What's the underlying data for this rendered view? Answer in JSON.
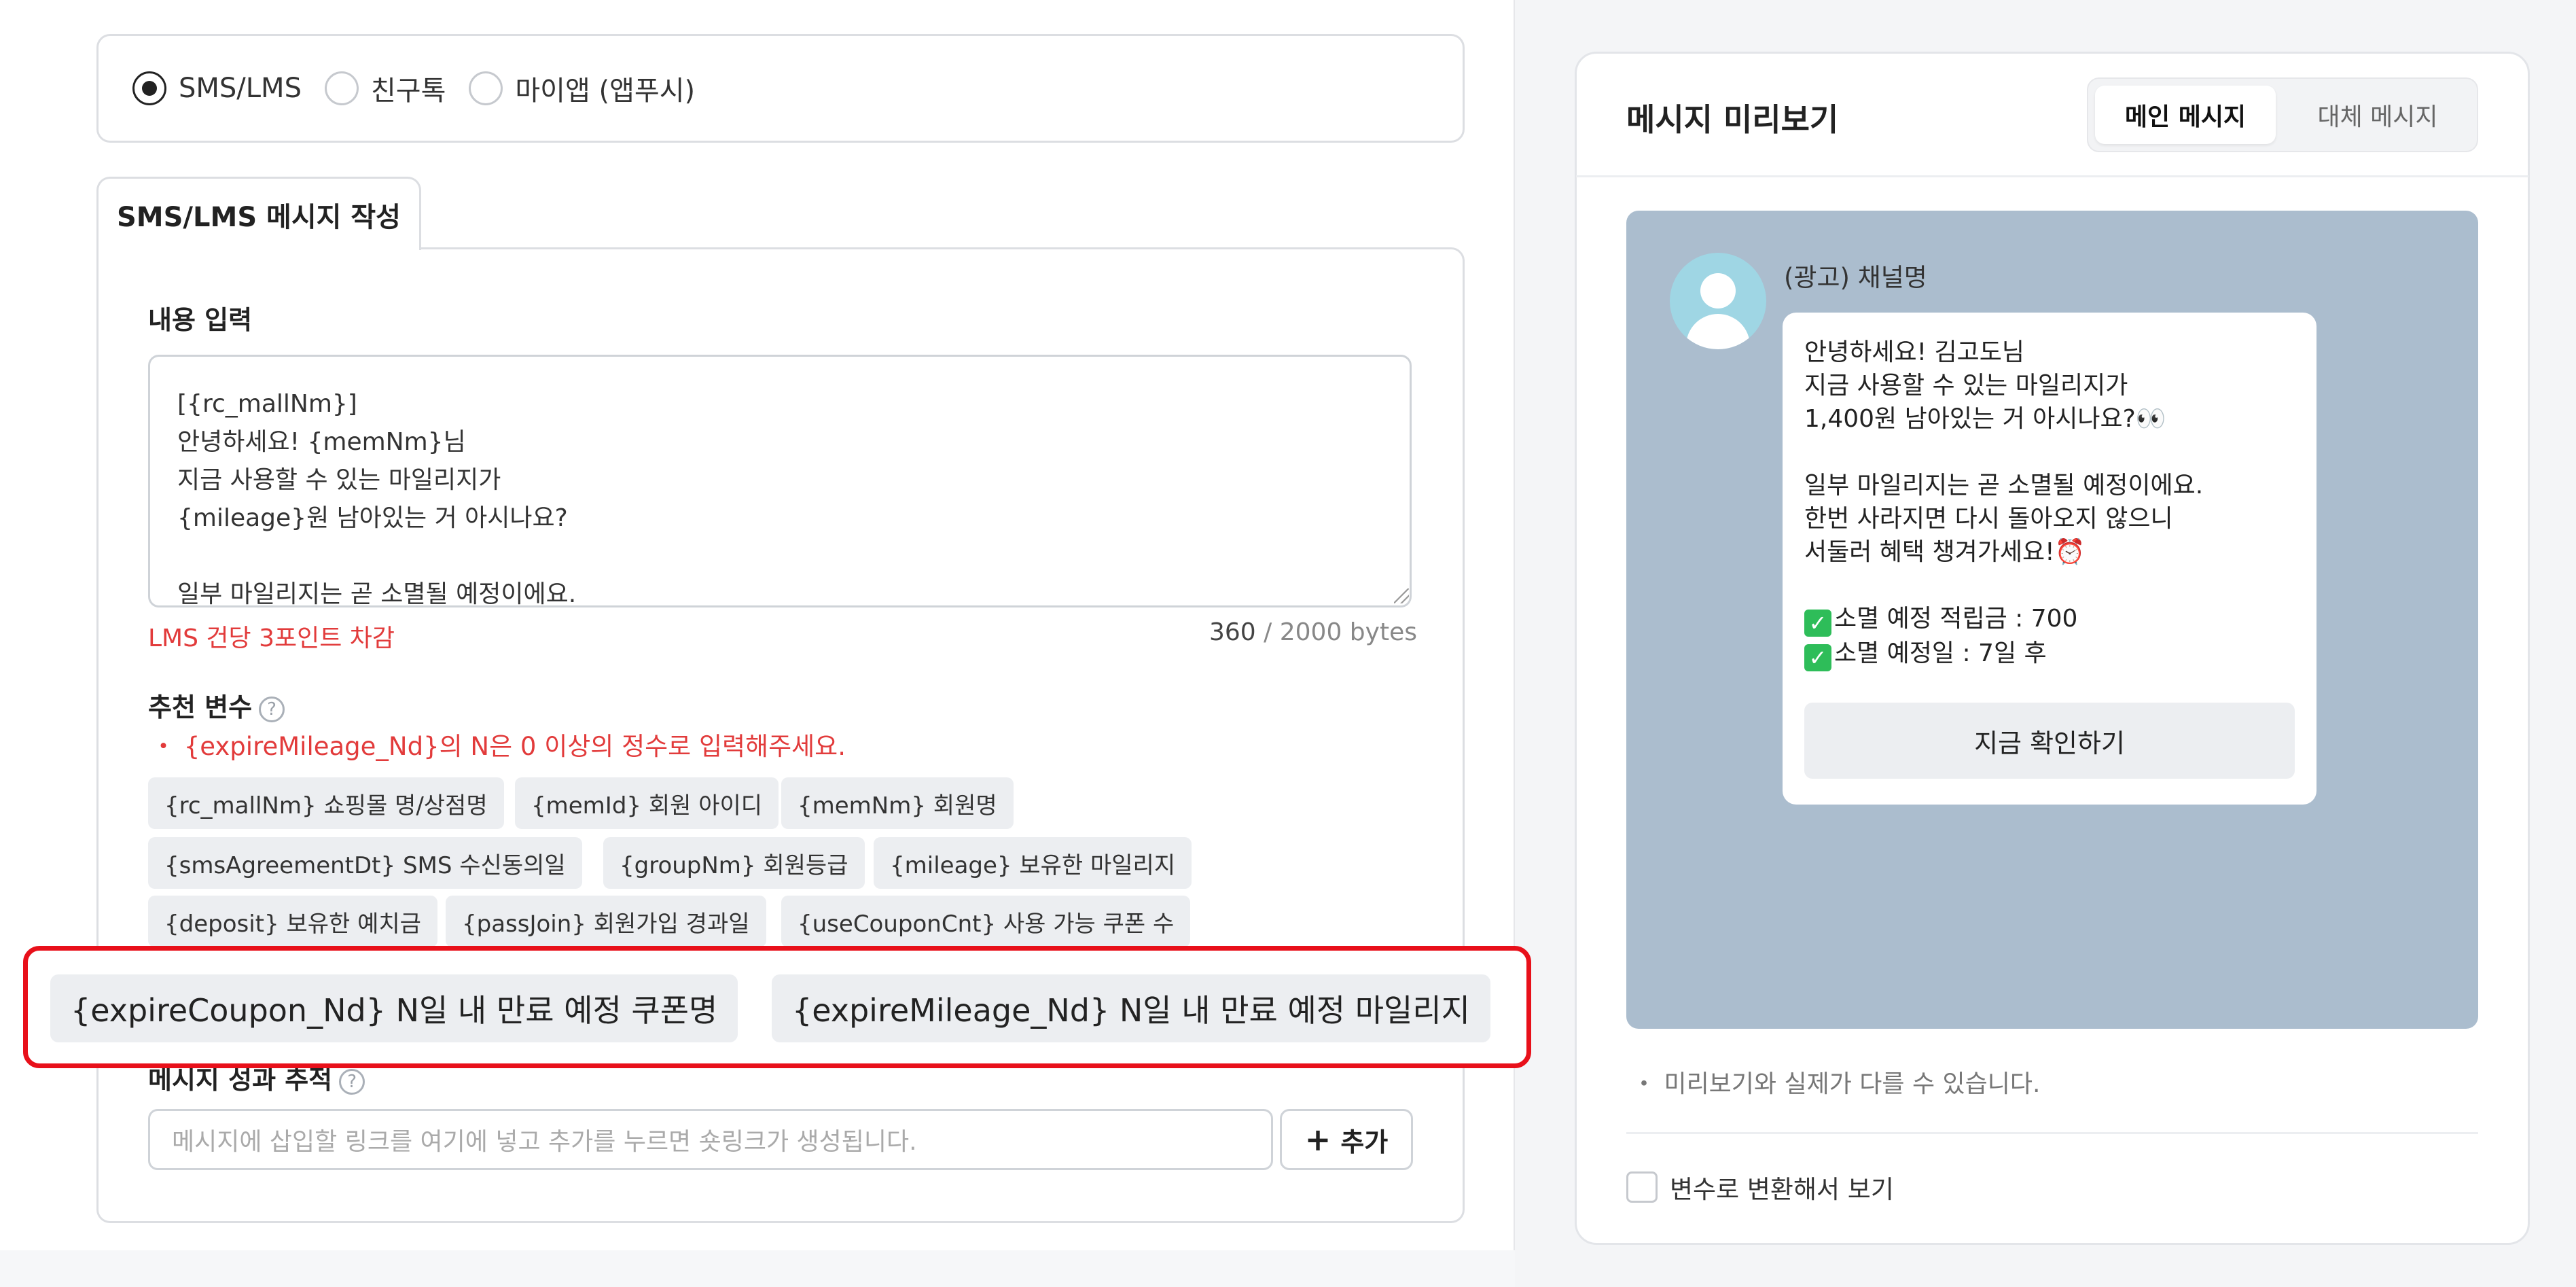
{
  "channels": {
    "options": [
      "SMS/LMS",
      "친구톡",
      "마이앱 (앱푸시)"
    ],
    "selected": "SMS/LMS"
  },
  "compose": {
    "tab_label": "SMS/LMS 메시지 작성",
    "content_label": "내용 입력",
    "content_value": "[{rc_mallNm}]\n안녕하세요! {memNm}님\n지금 사용할 수 있는 마일리지가\n{mileage}원 남아있는 거 아시나요?\n\n일부 마일리지는 곧 소멸될 예정이에요.",
    "lms_note": "LMS 건당 3포인트 차감",
    "byte_used": "360",
    "byte_total": " / 2000 bytes"
  },
  "variables": {
    "label": "추천 변수",
    "help_icon": "?",
    "warning": "・ {expireMileage_Nd}의 N은 0 이상의 정수로 입력해주세요.",
    "chips": [
      "{rc_mallNm} 쇼핑몰 명/상점명",
      "{memId} 회원 아이디",
      "{memNm} 회원명",
      "{smsAgreementDt} SMS 수신동의일",
      "{groupNm} 회원등급",
      "{mileage} 보유한 마일리지",
      "{deposit} 보유한 예치금",
      "{passJoin} 회원가입 경과일",
      "{useCouponCnt} 사용 가능 쿠폰 수"
    ],
    "highlighted_chips": [
      "{expireCoupon_Nd} N일 내 만료 예정 쿠폰명",
      "{expireMileage_Nd} N일 내 만료 예정 마일리지"
    ]
  },
  "tracking": {
    "label": "메시지 성과 추적",
    "help_icon": "?",
    "link_placeholder": "메시지에 삽입할 링크를 여기에 넣고 추가를 누르면 숏링크가 생성됩니다.",
    "add_icon": "+",
    "add_label": "추가"
  },
  "preview": {
    "title": "메시지 미리보기",
    "tabs": [
      "메인 메시지",
      "대체 메시지"
    ],
    "active_tab": "메인 메시지",
    "channel_name": "(광고) 채널명",
    "message_lines": [
      "안녕하세요! 김고도님",
      "지금 사용할 수 있는 마일리지가",
      "1,400원 남아있는 거 아시나요?👀",
      "",
      "일부 마일리지는 곧 소멸될 예정이에요.",
      "한번 사라지면 다시 돌아오지 않으니",
      "서둘러 혜택 챙겨가세요!⏰",
      ""
    ],
    "check_mark": "✓",
    "check_lines": [
      "소멸 예정 적립금 : 700",
      "소멸 예정일 : 7일 후"
    ],
    "button_label": "지금 확인하기",
    "note": "・ 미리보기와 실제가 다를 수 있습니다.",
    "variable_toggle_label": "변수로 변환해서 보기"
  },
  "colors": {
    "accent_red": "#e8101a",
    "warning_red": "#e23b3b",
    "preview_bg": "#abbdce",
    "avatar": "#9fd6e4"
  },
  "icons": [
    "radio-icon",
    "help-icon",
    "plus-icon",
    "avatar-icon",
    "check-emoji-icon",
    "eyes-emoji",
    "alarm-clock-emoji"
  ]
}
